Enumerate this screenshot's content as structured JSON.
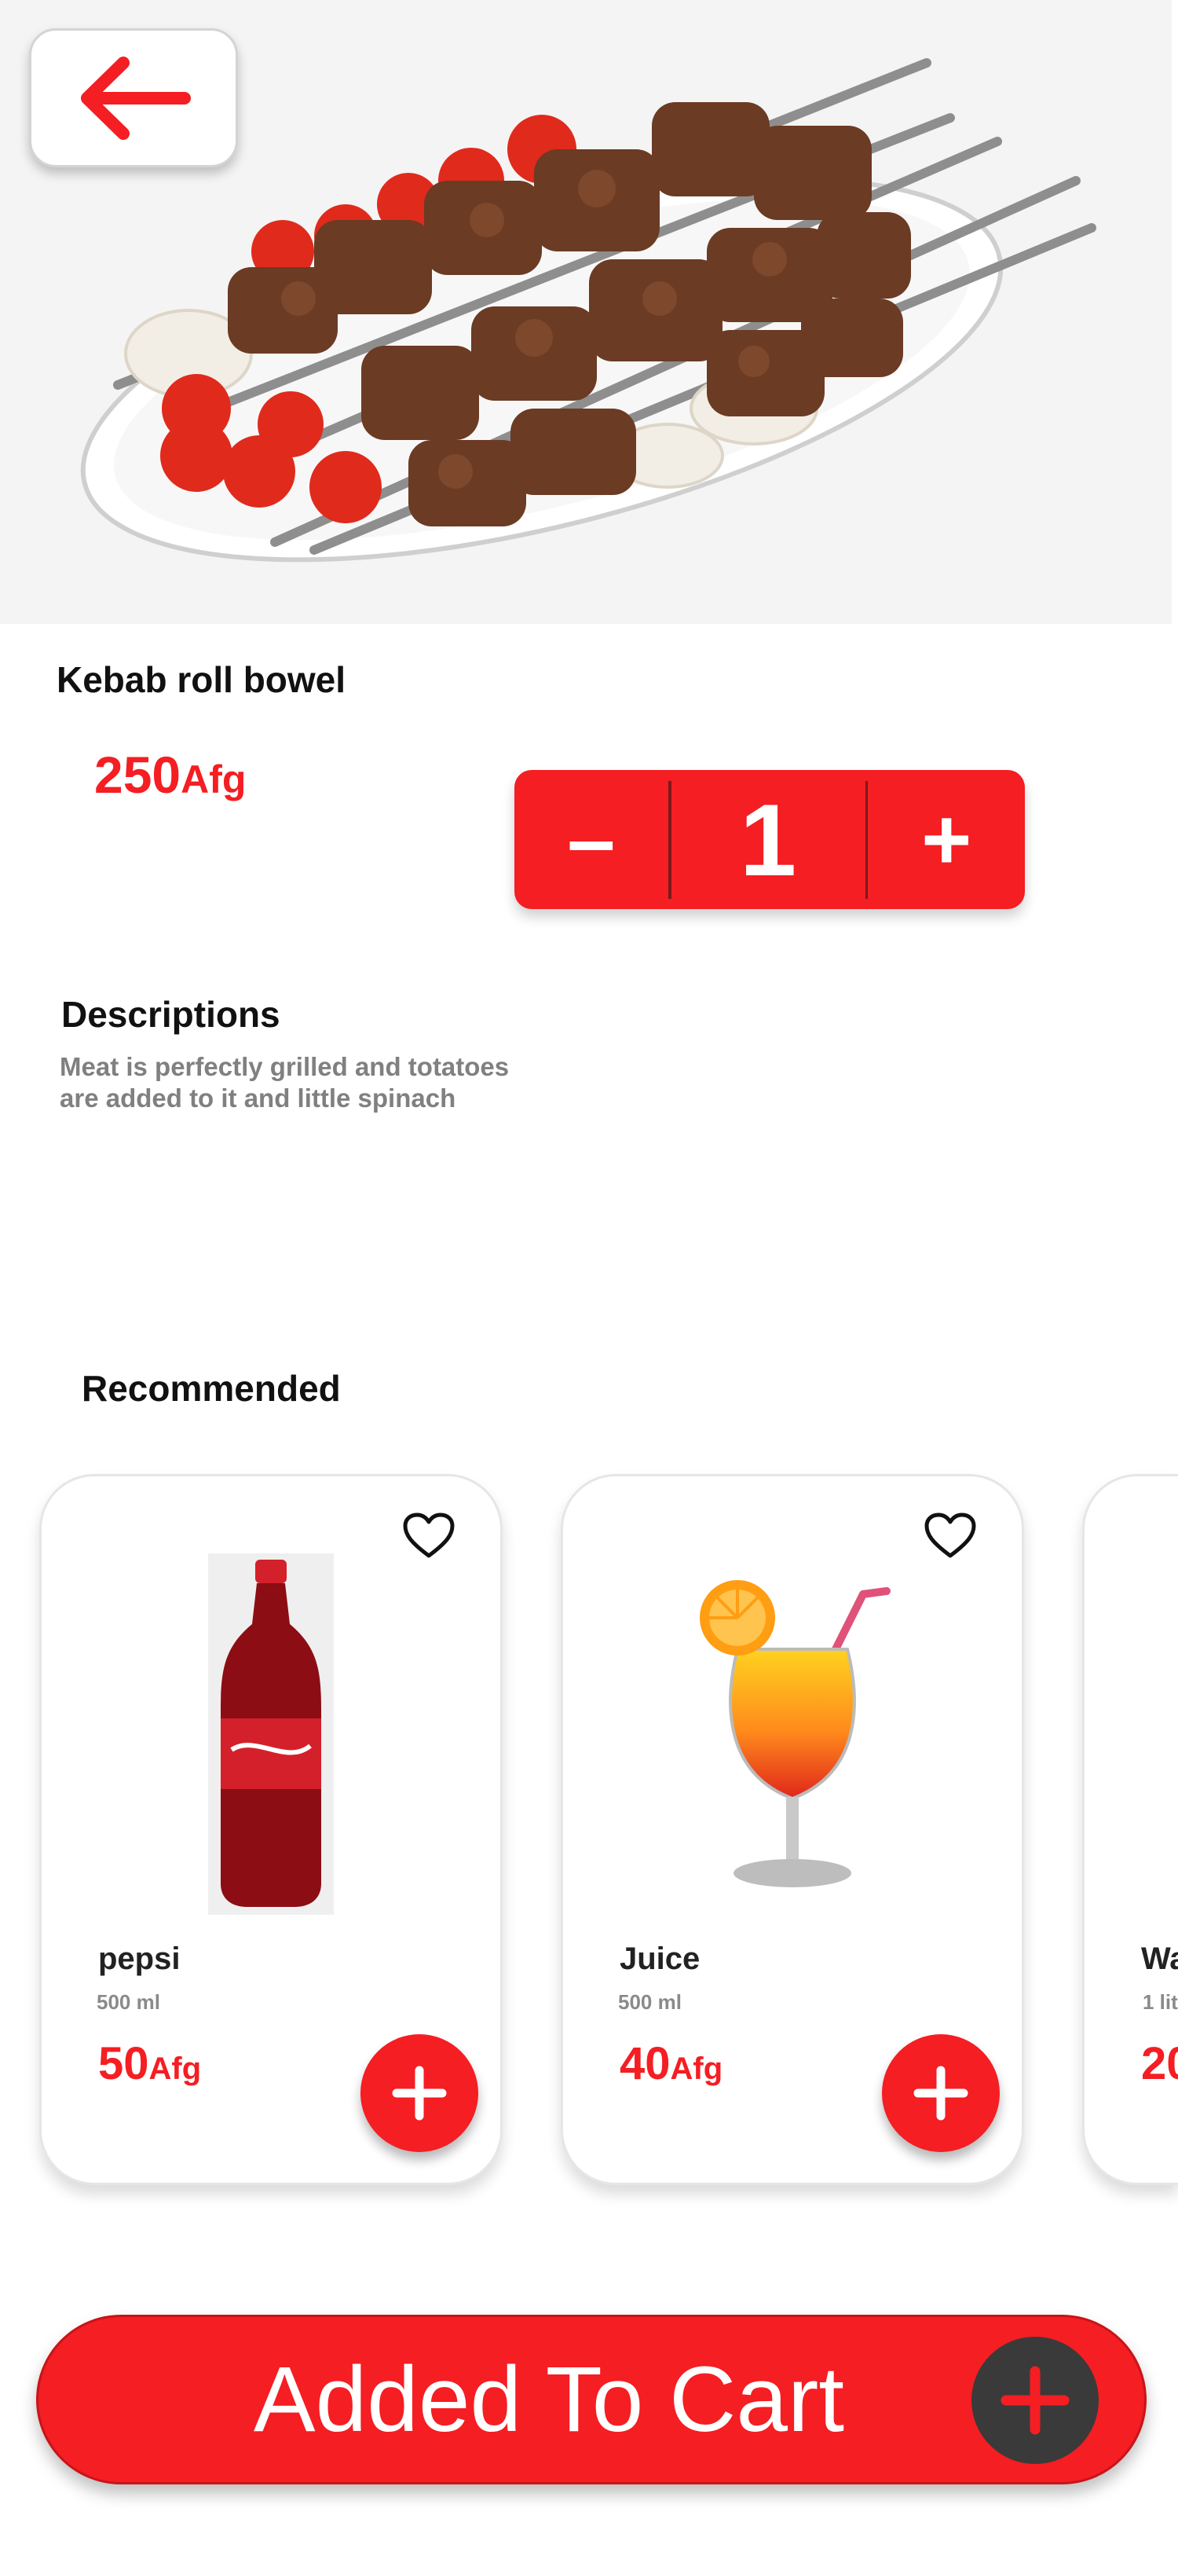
{
  "product": {
    "title": "Kebab roll bowel",
    "price_amount": "250",
    "price_currency": "Afg",
    "quantity": "1",
    "minus_label": "–",
    "plus_label": "+",
    "image_icon": "kebab-plate-image"
  },
  "description": {
    "heading": "Descriptions",
    "text": "Meat  is perfectly grilled and totatoes are added to it and little spinach"
  },
  "recommended": {
    "heading": "Recommended",
    "items": [
      {
        "name": "pepsi",
        "volume": "500 ml",
        "price_amount": "50",
        "price_currency": "Afg",
        "image_icon": "cola-bottle-image"
      },
      {
        "name": "Juice",
        "volume": "500 ml",
        "price_amount": "40",
        "price_currency": "Afg",
        "image_icon": "juice-glass-image"
      },
      {
        "name": "Wa",
        "volume": "1 lit",
        "price_amount": "20",
        "price_currency": ""
      }
    ]
  },
  "footer": {
    "cart_label": "Added To Cart"
  },
  "colors": {
    "accent": "#f41e23",
    "dark": "#3a3a3a",
    "muted_text": "#808080"
  }
}
